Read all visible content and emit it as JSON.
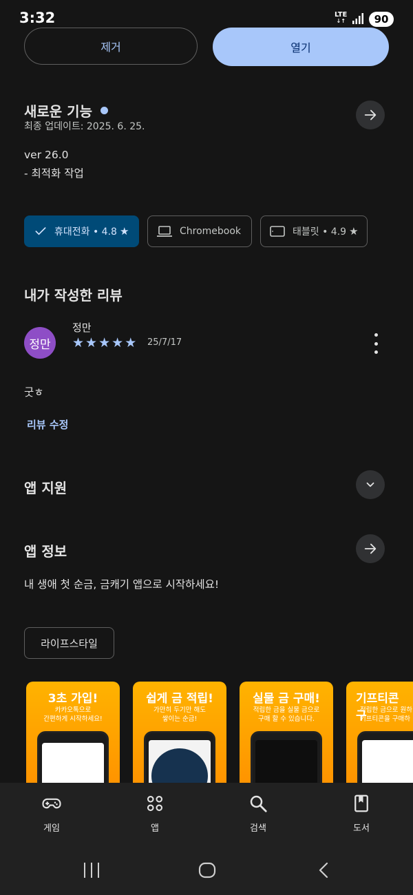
{
  "status": {
    "time": "3:32",
    "network": "LTE",
    "battery": "90"
  },
  "actions": {
    "remove_label": "제거",
    "open_label": "열기"
  },
  "whats_new": {
    "title": "새로운 기능",
    "updated": "최종 업데이트: 2025. 6. 25.",
    "version": "ver 26.0",
    "note": "- 최적화 작업"
  },
  "devices": [
    {
      "label": "휴대전화 • 4.8",
      "icon": "check-icon",
      "selected": true
    },
    {
      "label": "Chromebook",
      "icon": "laptop-icon",
      "selected": false
    },
    {
      "label": "태블릿 • 4.9",
      "icon": "tablet-icon",
      "selected": false
    }
  ],
  "my_review": {
    "title": "내가 작성한 리뷰",
    "avatar_text": "정만",
    "name": "정만",
    "rating": 5,
    "date": "25/7/17",
    "text": "굿ㅎ",
    "edit_label": "리뷰 수정"
  },
  "app_support": {
    "title": "앱 지원"
  },
  "app_info": {
    "title": "앱 정보",
    "description": "내 생애 첫 순금, 금캐기 앱으로 시작하세요!",
    "category": "라이프스타일"
  },
  "screenshots": [
    {
      "title": "3초 가입!",
      "sub1": "카카오톡으로",
      "sub2": "간편하게 시작하세요!"
    },
    {
      "title": "쉽게 금 적립!",
      "sub1": "가만히 두기만 해도",
      "sub2": "쌓이는 순금!"
    },
    {
      "title": "실물 금 구매!",
      "sub1": "적립한 금을 실물 금으로",
      "sub2": "구매 할 수 있습니다."
    },
    {
      "title": "기프티콘 구",
      "sub1": "적립한 금으로 원하",
      "sub2": "기프티콘을 구매하"
    }
  ],
  "bottom_nav": [
    {
      "label": "게임",
      "icon": "gamepad-icon"
    },
    {
      "label": "앱",
      "icon": "apps-grid-icon"
    },
    {
      "label": "검색",
      "icon": "search-icon"
    },
    {
      "label": "도서",
      "icon": "book-icon"
    }
  ],
  "colors": {
    "accent": "#a8c7fa",
    "selected_chip": "#004a77",
    "avatar": "#8e4ec6",
    "background": "#151515"
  }
}
